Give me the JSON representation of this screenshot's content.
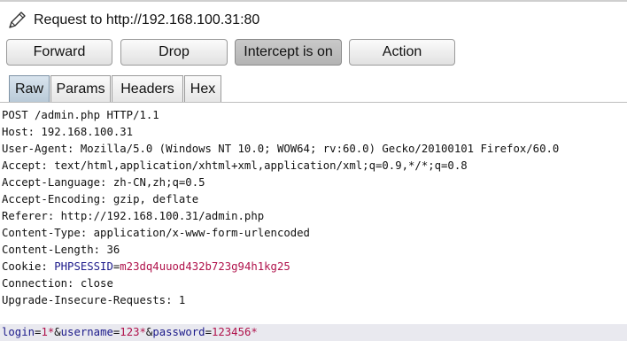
{
  "request": {
    "title": "Request to http://192.168.100.31:80"
  },
  "toolbar": {
    "forward_label": "Forward",
    "drop_label": "Drop",
    "intercept_label": "Intercept is on",
    "action_label": "Action"
  },
  "tabs": [
    {
      "label": "Raw",
      "active": true
    },
    {
      "label": "Params",
      "active": false
    },
    {
      "label": "Headers",
      "active": false
    },
    {
      "label": "Hex",
      "active": false
    }
  ],
  "raw": {
    "request_line": "POST /admin.php HTTP/1.1",
    "host": "Host: 192.168.100.31",
    "user_agent": "User-Agent: Mozilla/5.0 (Windows NT 10.0; WOW64; rv:60.0) Gecko/20100101 Firefox/60.0",
    "accept": "Accept: text/html,application/xhtml+xml,application/xml;q=0.9,*/*;q=0.8",
    "accept_language": "Accept-Language: zh-CN,zh;q=0.5",
    "accept_encoding": "Accept-Encoding: gzip, deflate",
    "referer": "Referer: http://192.168.100.31/admin.php",
    "content_type": "Content-Type: application/x-www-form-urlencoded",
    "content_length": "Content-Length: 36",
    "cookie": {
      "prefix": "Cookie: ",
      "name": "PHPSESSID",
      "eq": "=",
      "value": "m23dq4uuod432b723g94h1kg25"
    },
    "connection": "Connection: close",
    "upgrade": "Upgrade-Insecure-Requests: 1",
    "body": {
      "p1_name": "login",
      "p1_eq": "=",
      "p1_val": "1*",
      "amp1": "&",
      "p2_name": "username",
      "p2_eq": "=",
      "p2_val": "123*",
      "amp2": "&",
      "p3_name": "password",
      "p3_eq": "=",
      "p3_val": "123456*"
    }
  },
  "colors": {
    "param_name": "#1c1a8a",
    "param_value": "#b0124b",
    "active_tab": "#c4d3e0",
    "body_highlight": "#e9e9ef"
  },
  "icons": {
    "header_icon": "pencil-icon"
  }
}
